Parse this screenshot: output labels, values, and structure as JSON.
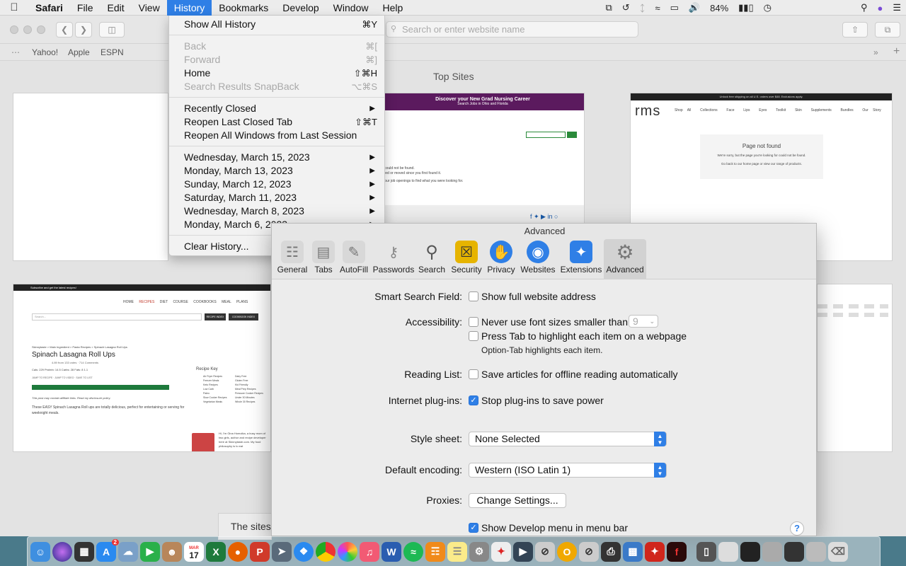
{
  "menubar": {
    "app_name": "Safari",
    "items": [
      "File",
      "Edit",
      "View",
      "History",
      "Bookmarks",
      "Develop",
      "Window",
      "Help"
    ],
    "active": "History",
    "battery": "84%"
  },
  "toolbar": {
    "address_placeholder": "Search or enter website name"
  },
  "favorites": [
    "Yahoo!",
    "Apple",
    "ESPN"
  ],
  "topsites": {
    "title": "Top Sites",
    "thumb_nursing": {
      "header": "Discover your New Grad Nursing Career",
      "sub": "Search Jobs in Ohio and Florida",
      "lines": [
        "e could not be found.",
        "oved or moved since you first found it.",
        "h our job openings to find what you were looking for."
      ]
    },
    "thumb_rms": {
      "banner": "Unlock free shipping on all U.S. orders over $48. Exclusions apply.",
      "logo": "rms",
      "nav": [
        "Shop All",
        "Collections",
        "Face",
        "Lips",
        "Eyes",
        "Toolkit",
        "Skin",
        "Supplements",
        "Bundles",
        "Our Story"
      ],
      "notfound_title": "Page not found",
      "notfound_text": "We're sorry, but the page you're looking for could not be found.",
      "notfound_link": "Go back to our home page or view our range of products."
    },
    "thumb_recipe": {
      "topbar": "Subscribe and get the latest recipes!",
      "nav": [
        "HOME",
        "RECIPES",
        "DIET",
        "COURSE",
        "COOKBOOKS",
        "MEAL PLANS"
      ],
      "search": "Search...",
      "btn1": "RECIPE INDEX",
      "btn2": "COOKBOOK INDEX",
      "breadcrumb": "Skinnytaste > Main Ingredient > Pasta Recipes > Spinach Lasagna Roll Ups",
      "title": "Spinach Lasagna Roll Ups",
      "rating": "4.89 from 133 votes · 714 Comments",
      "nutrition": "Cals: 229  Protein: 14.5  Carbs: 28  Fats: 8  1.1",
      "jump": "JUMP TO RECIPE  ·  JUMP TO VIDEO  ·  SAVE TO LIST",
      "disclosure": "This post may contain affiliate links. Read my disclosure policy.",
      "intro": "These EASY Spinach Lasagna Roll ups are totally delicious, perfect for entertaining or serving for weeknight meals.",
      "key_title": "Recipe Key",
      "key_items": [
        "Air Fryer Recipes",
        "Dairy Free",
        "Freezer Meals",
        "Gluten Free",
        "Keto Recipes",
        "Kid Friendly",
        "Low Carb",
        "Meal Prep Recipes",
        "Paleo",
        "Pressure Cooker Recipes",
        "Slow Cooker Recipes",
        "Under 30 Minutes",
        "Vegetarian Meals",
        "Whole 30 Recipes"
      ],
      "bio": "Hi, I'm Gina Homolka, a busy mom of two girls, author and recipe developer here at Skinnytaste.com. My food philosophy is to eat"
    },
    "sites_note": "The sites"
  },
  "history_menu": {
    "show_all": "Show All History",
    "show_all_sc": "⌘Y",
    "back": "Back",
    "back_sc": "⌘[",
    "forward": "Forward",
    "forward_sc": "⌘]",
    "home": "Home",
    "home_sc": "⇧⌘H",
    "snapback": "Search Results SnapBack",
    "snapback_sc": "⌥⌘S",
    "recently_closed": "Recently Closed",
    "reopen_tab": "Reopen Last Closed Tab",
    "reopen_tab_sc": "⇧⌘T",
    "reopen_windows": "Reopen All Windows from Last Session",
    "dates": [
      "Wednesday, March 15, 2023",
      "Monday, March 13, 2023",
      "Sunday, March 12, 2023",
      "Saturday, March 11, 2023",
      "Wednesday, March 8, 2023",
      "Monday, March 6, 2023"
    ],
    "clear": "Clear History..."
  },
  "prefs": {
    "title": "Advanced",
    "tabs": [
      "General",
      "Tabs",
      "AutoFill",
      "Passwords",
      "Search",
      "Security",
      "Privacy",
      "Websites",
      "Extensions",
      "Advanced"
    ],
    "selected_tab": "Advanced",
    "smart_search_label": "Smart Search Field:",
    "smart_search_opt": "Show full website address",
    "accessibility_label": "Accessibility:",
    "font_size_opt": "Never use font sizes smaller than",
    "font_size_value": "9",
    "tab_highlight_opt": "Press Tab to highlight each item on a webpage",
    "tab_highlight_sub": "Option-Tab highlights each item.",
    "reading_list_label": "Reading List:",
    "reading_list_opt": "Save articles for offline reading automatically",
    "plugins_label": "Internet plug-ins:",
    "plugins_opt": "Stop plug-ins to save power",
    "stylesheet_label": "Style sheet:",
    "stylesheet_value": "None Selected",
    "encoding_label": "Default encoding:",
    "encoding_value": "Western (ISO Latin 1)",
    "proxies_label": "Proxies:",
    "proxies_button": "Change Settings...",
    "develop_opt": "Show Develop menu in menu bar",
    "help": "?"
  },
  "dock": {
    "calendar_month": "MAR",
    "calendar_day": "17",
    "appstore_badge": "2"
  }
}
